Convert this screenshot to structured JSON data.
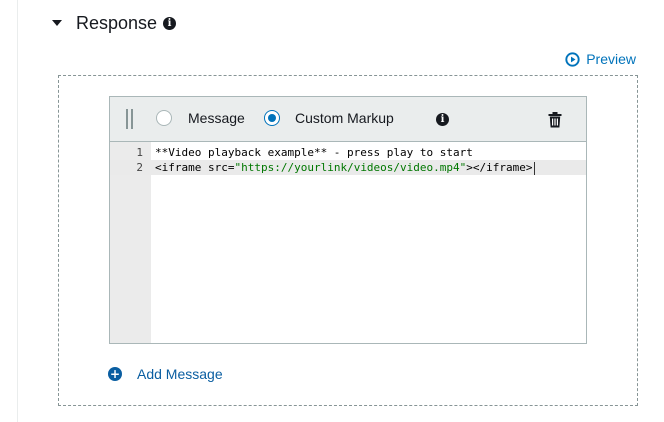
{
  "response": {
    "title": "Response",
    "preview_label": "Preview"
  },
  "editor": {
    "radio_message_label": "Message",
    "radio_custom_label": "Custom Markup",
    "selected_option": "Custom Markup",
    "lines": [
      {
        "number": "1",
        "text": "**Video playback example** - press play to start"
      },
      {
        "number": "2",
        "tag_open": "<iframe src=",
        "url": "\"https://yourlink/videos/video.mp4\"",
        "tag_close": "></iframe>"
      }
    ]
  },
  "add_message_label": "Add Message",
  "colors": {
    "link": "#0073bb",
    "add_link": "#0a5ea1",
    "string": "#007700",
    "toolbar_bg": "#eaeded",
    "gutter_bg": "#ebebeb"
  },
  "icons": [
    "caret-down-icon",
    "info-icon",
    "play-circle-icon",
    "drag-handle-icon",
    "trash-icon",
    "plus-circle-icon"
  ]
}
